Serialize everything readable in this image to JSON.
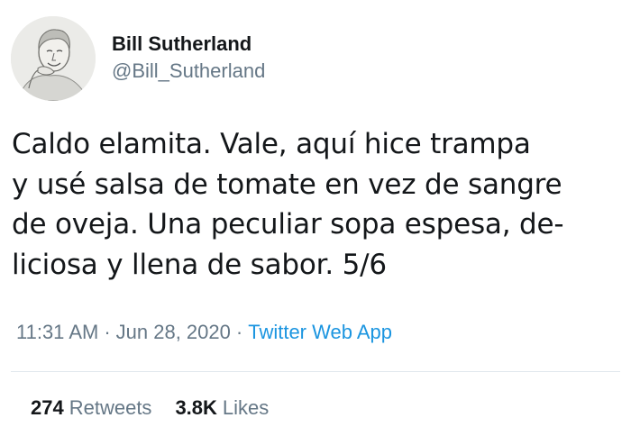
{
  "author": {
    "display_name": "Bill Sutherland",
    "handle": "@Bill_Sutherland",
    "avatar_icon": "avatar-portrait-icon"
  },
  "tweet": {
    "lines": [
      "Caldo elamita. Vale, aquí hice trampa",
      "y usé salsa de tomate en vez de sangre",
      "de oveja. Una peculiar sopa espesa, de-",
      "liciosa y llena de sabor. 5/6"
    ]
  },
  "meta": {
    "time": "11:31 AM",
    "separator": "·",
    "date": "Jun 28, 2020",
    "source": "Twitter Web App"
  },
  "stats": {
    "retweets_count": "274",
    "retweets_label": "Retweets",
    "likes_count": "3.8K",
    "likes_label": "Likes"
  },
  "colors": {
    "text": "#14171a",
    "secondary": "#657786",
    "link": "#1b95e0",
    "divider": "#e1e8ed"
  }
}
